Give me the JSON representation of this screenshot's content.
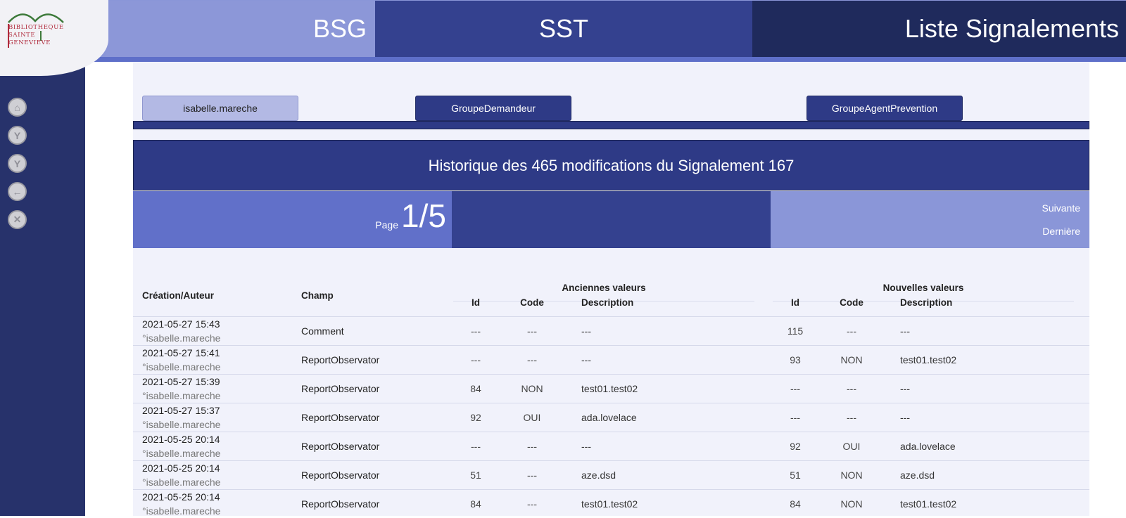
{
  "header": {
    "logo_lines": [
      "BIBLIOTHEQUE",
      "SAINTE",
      "GENEVIEVE"
    ],
    "section_bsg": "BSG",
    "section_sst": "SST",
    "section_page": "Liste Signalements"
  },
  "sidebar": {
    "buttons": [
      {
        "name": "home",
        "glyph": "⌂"
      },
      {
        "name": "branch-1",
        "glyph": "Y"
      },
      {
        "name": "branch-2",
        "glyph": "Y"
      },
      {
        "name": "back",
        "glyph": "←"
      },
      {
        "name": "close",
        "glyph": "✕"
      }
    ]
  },
  "tabs": {
    "user": "isabelle.mareche",
    "group1": "GroupeDemandeur",
    "group2": "GroupeAgentPrevention"
  },
  "title": "Historique des 465 modifications du Signalement 167",
  "pager": {
    "label": "Page",
    "current": "1/5",
    "next": "Suivante",
    "last": "Dernière"
  },
  "table": {
    "headers": {
      "creation": "Création/Auteur",
      "champ": "Champ",
      "old_group": "Anciennes valeurs",
      "new_group": "Nouvelles valeurs",
      "id": "Id",
      "code": "Code",
      "description": "Description"
    },
    "rows": [
      {
        "date": "2021-05-27 15:43",
        "author": "°isabelle.mareche",
        "champ": "Comment",
        "old_id": "---",
        "old_code": "---",
        "old_desc": "---",
        "new_id": "115",
        "new_code": "---",
        "new_desc": "---"
      },
      {
        "date": "2021-05-27 15:41",
        "author": "°isabelle.mareche",
        "champ": "ReportObservator",
        "old_id": "---",
        "old_code": "---",
        "old_desc": "---",
        "new_id": "93",
        "new_code": "NON",
        "new_desc": "test01.test02"
      },
      {
        "date": "2021-05-27 15:39",
        "author": "°isabelle.mareche",
        "champ": "ReportObservator",
        "old_id": "84",
        "old_code": "NON",
        "old_desc": "test01.test02",
        "new_id": "---",
        "new_code": "---",
        "new_desc": "---"
      },
      {
        "date": "2021-05-27 15:37",
        "author": "°isabelle.mareche",
        "champ": "ReportObservator",
        "old_id": "92",
        "old_code": "OUI",
        "old_desc": "ada.lovelace",
        "new_id": "---",
        "new_code": "---",
        "new_desc": "---"
      },
      {
        "date": "2021-05-25 20:14",
        "author": "°isabelle.mareche",
        "champ": "ReportObservator",
        "old_id": "---",
        "old_code": "---",
        "old_desc": "---",
        "new_id": "92",
        "new_code": "OUI",
        "new_desc": "ada.lovelace"
      },
      {
        "date": "2021-05-25 20:14",
        "author": "°isabelle.mareche",
        "champ": "ReportObservator",
        "old_id": "51",
        "old_code": "---",
        "old_desc": "aze.dsd",
        "new_id": "51",
        "new_code": "NON",
        "new_desc": "aze.dsd"
      },
      {
        "date": "2021-05-25 20:14",
        "author": "°isabelle.mareche",
        "champ": "ReportObservator",
        "old_id": "84",
        "old_code": "---",
        "old_desc": "test01.test02",
        "new_id": "84",
        "new_code": "NON",
        "new_desc": "test01.test02"
      }
    ]
  }
}
